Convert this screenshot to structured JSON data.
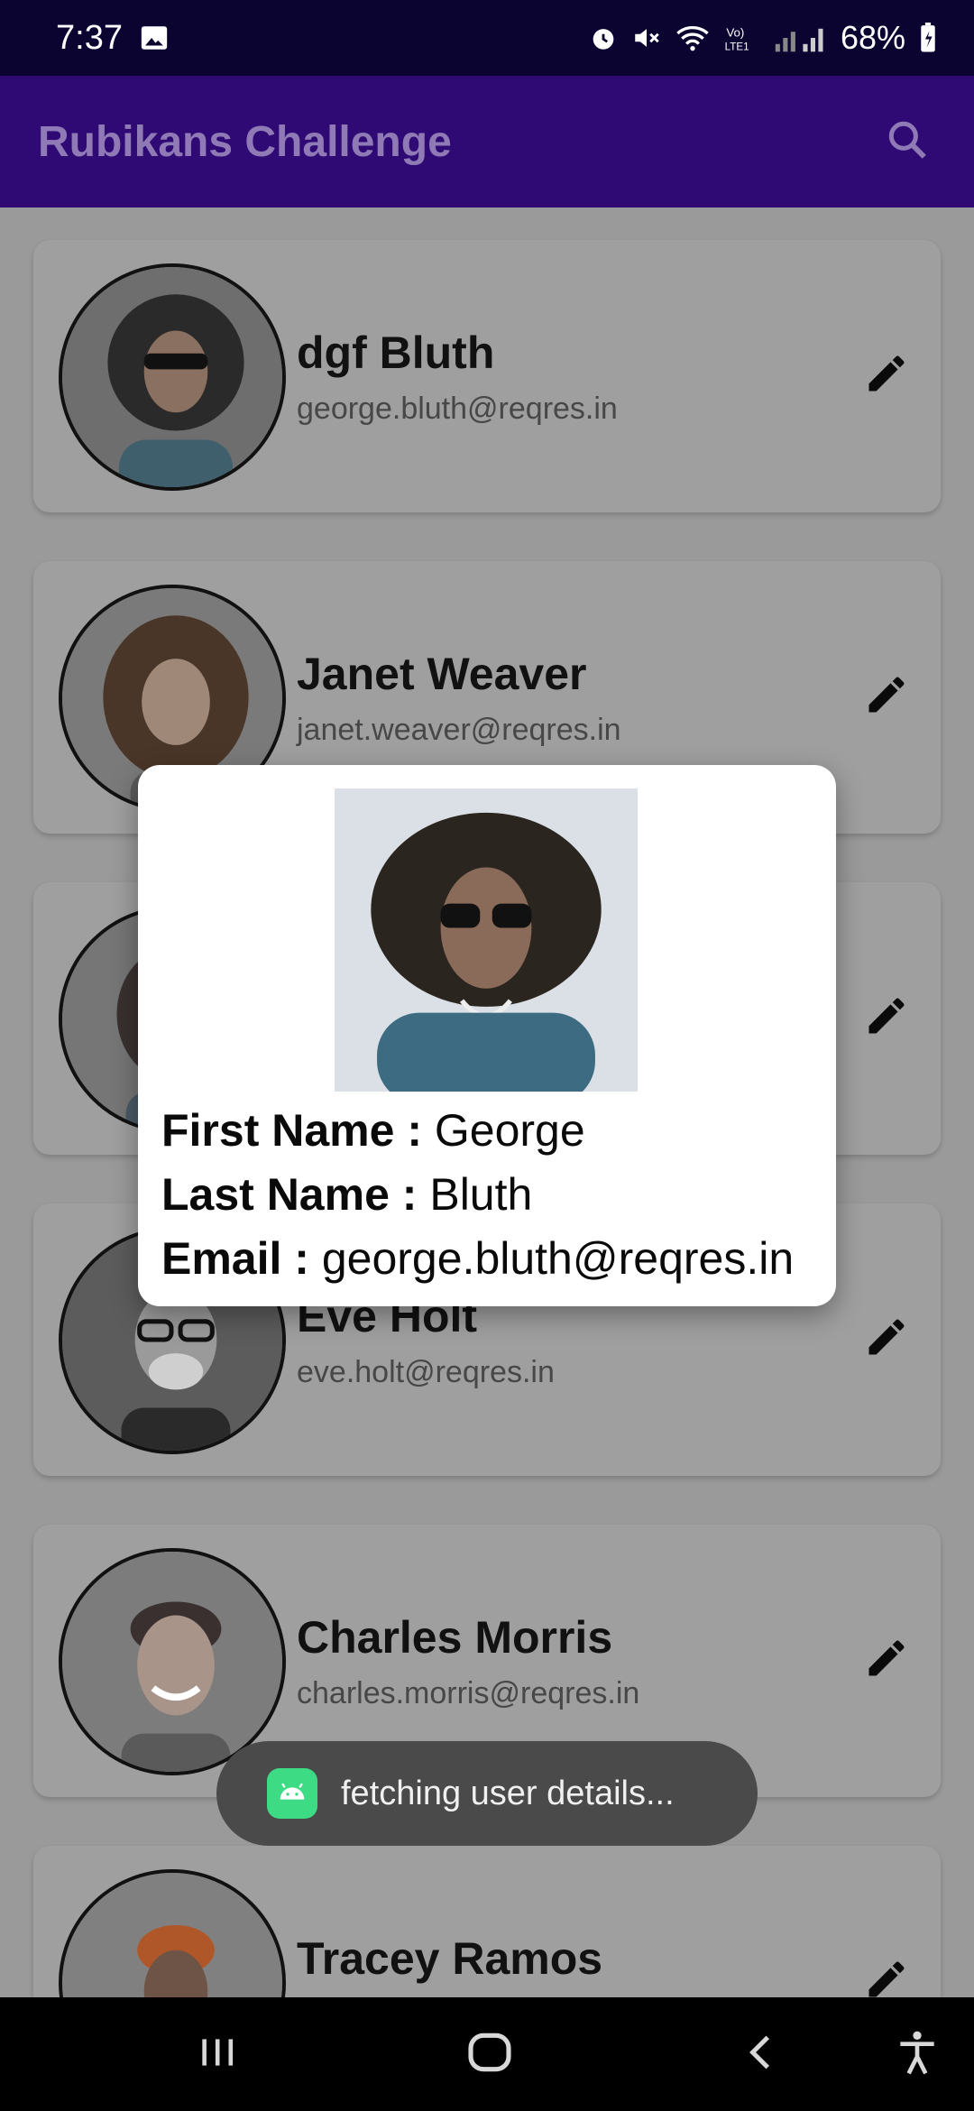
{
  "status_bar": {
    "time": "7:37",
    "battery": "68%"
  },
  "app_bar": {
    "title": "Rubikans Challenge"
  },
  "users": [
    {
      "name": "dgf Bluth",
      "email": "george.bluth@reqres.in"
    },
    {
      "name": "Janet Weaver",
      "email": "janet.weaver@reqres.in"
    },
    {
      "name": "",
      "email": ""
    },
    {
      "name": "Eve Holt",
      "email": "eve.holt@reqres.in"
    },
    {
      "name": "Charles Morris",
      "email": "charles.morris@reqres.in"
    },
    {
      "name": "Tracey Ramos",
      "email": ""
    }
  ],
  "dialog": {
    "first_name_label": "First Name :",
    "first_name": "George",
    "last_name_label": "Last Name :",
    "last_name": "Bluth",
    "email_label": "Email :",
    "email": "george.bluth@reqres.in"
  },
  "toast": {
    "text": "fetching user details..."
  },
  "icons": {
    "status": [
      "gallery-icon",
      "alarm-icon",
      "mute-icon",
      "wifi-icon",
      "volte-icon",
      "signal-icon",
      "battery-icon"
    ],
    "app_bar": "search-icon",
    "card": "pencil-icon",
    "nav": [
      "recents-icon",
      "home-icon",
      "back-icon",
      "accessibility-icon"
    ]
  },
  "colors": {
    "status_bar": "#0b0330",
    "app_bar": "#2f0a74",
    "title": "#8f7ab6",
    "scrim_bg": "#9a9a9a",
    "toast": "#4a4a4a"
  }
}
